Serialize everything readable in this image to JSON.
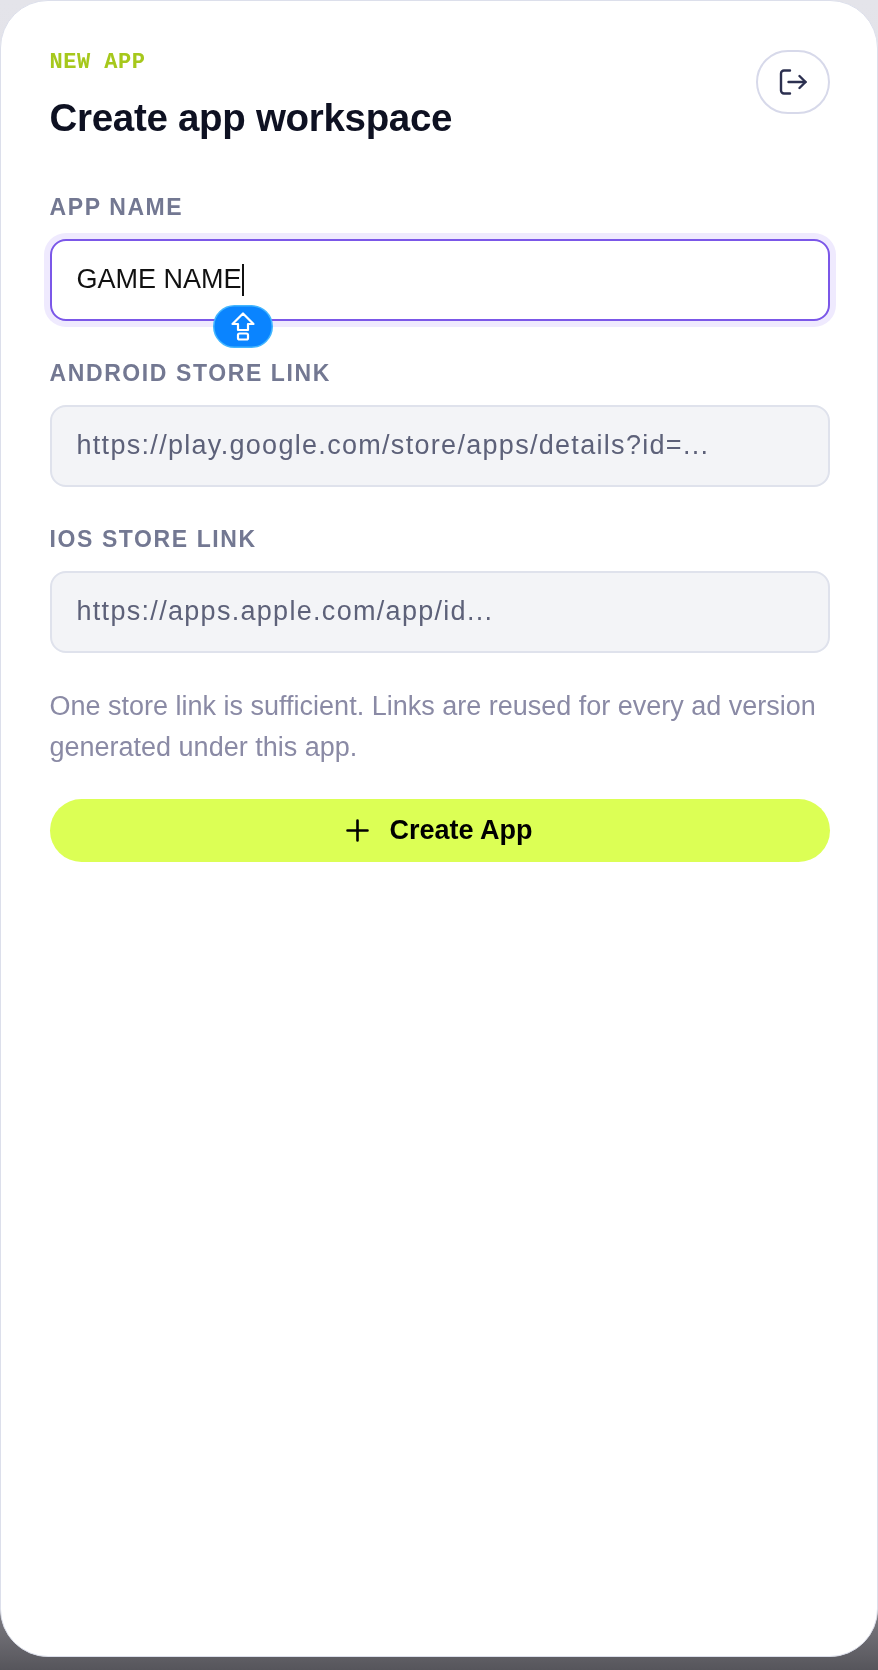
{
  "header": {
    "eyebrow": "NEW APP",
    "title": "Create app workspace"
  },
  "fields": [
    {
      "label": "APP NAME",
      "value": "GAME NAME",
      "focused": true
    },
    {
      "label": "ANDROID STORE LINK",
      "placeholder": "https://play.google.com/store/apps/details?id=...",
      "focused": false
    },
    {
      "label": "IOS STORE LINK",
      "placeholder": "https://apps.apple.com/app/id...",
      "focused": false
    }
  ],
  "caps_lock": true,
  "hint": "One store link is sufficient. Links are reused for every ad version generated under this app.",
  "submit_button": {
    "label": "Create App"
  }
}
